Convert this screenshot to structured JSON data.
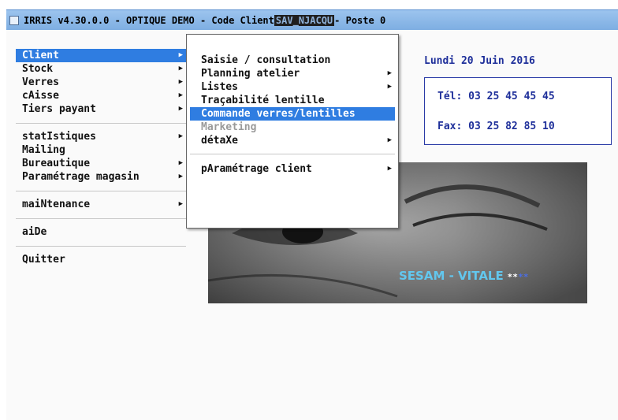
{
  "window": {
    "title_prefix": "IRRIS v4.30.0.0   - OPTIQUE DEMO - Code Client ",
    "client_code": "SAV_NJACQU",
    "title_suffix": " - Poste 0"
  },
  "main_menu": {
    "group1": [
      {
        "label": "Client",
        "arrow": "▶"
      },
      {
        "label": "Stock",
        "arrow": "▶"
      },
      {
        "label": "Verres",
        "arrow": "▶"
      },
      {
        "label": "cAisse",
        "arrow": "▶"
      },
      {
        "label": "Tiers payant",
        "arrow": "▶"
      }
    ],
    "group2": [
      {
        "label": "statIstiques",
        "arrow": "▶"
      },
      {
        "label": "Mailing"
      },
      {
        "label": "Bureautique",
        "arrow": "▶"
      },
      {
        "label": "Paramétrage magasin",
        "arrow": "▶"
      }
    ],
    "maintenance": {
      "label": "maiNtenance",
      "arrow": "▶"
    },
    "aide": {
      "label": "aiDe"
    },
    "quitter": {
      "label": "Quitter"
    }
  },
  "client_submenu": {
    "items": [
      {
        "label": "Saisie / consultation"
      },
      {
        "label": "Planning atelier",
        "arrow": "▶"
      },
      {
        "label": "Listes",
        "arrow": "▶"
      },
      {
        "label": "Traçabilité lentille"
      },
      {
        "label": "Commande verres/lentilles"
      },
      {
        "label": "Marketing"
      },
      {
        "label": "détaXe",
        "arrow": "▶"
      }
    ],
    "parametrage": {
      "label": "pAramétrage client",
      "arrow": "▶"
    }
  },
  "info": {
    "date": "Lundi 20 Juin 2016",
    "tel": "Tél: 03 25 45 45 45",
    "fax": "Fax: 03 25 82 85 10"
  },
  "banner": {
    "label": "SESAM - VITALE ",
    "stars_white": "**",
    "stars_blue": "**"
  }
}
